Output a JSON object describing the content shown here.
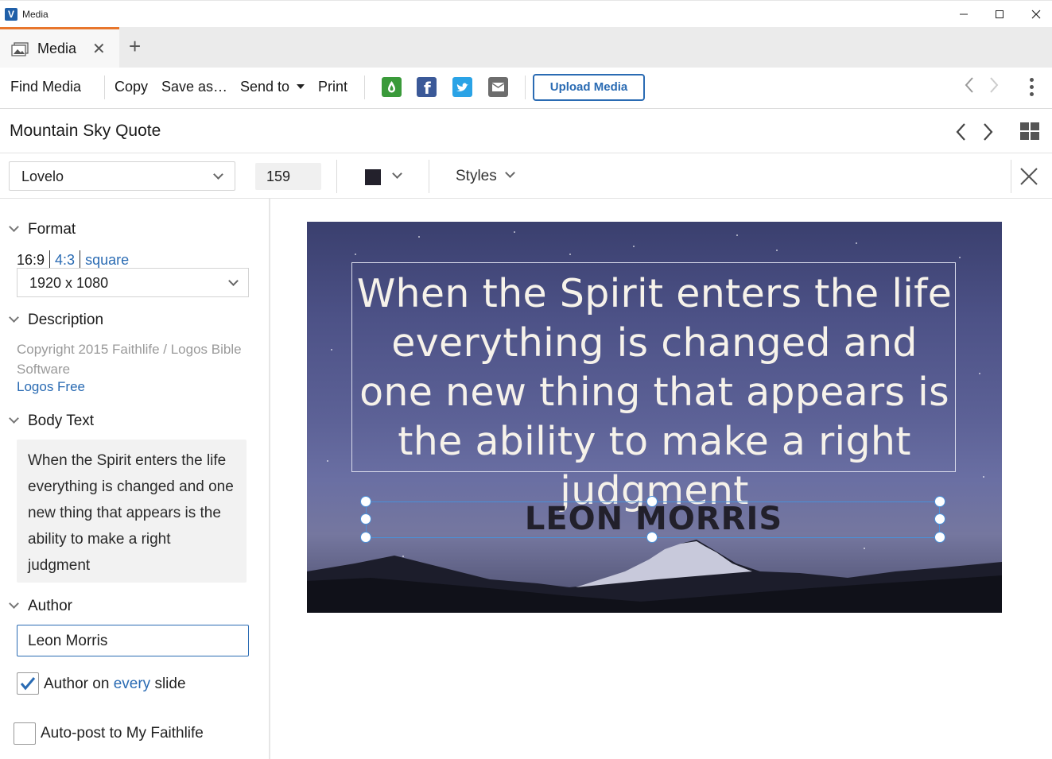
{
  "window": {
    "title": "Media",
    "minimize": "—",
    "maximize": "☐",
    "close": "✕"
  },
  "tabs": [
    {
      "label": "Media",
      "close": "✕"
    }
  ],
  "new_tab": "+",
  "toolbar": {
    "find_media": "Find Media",
    "copy": "Copy",
    "save_as": "Save as…",
    "send_to": "Send to",
    "print": "Print",
    "upload_media": "Upload Media",
    "back": "‹",
    "forward": "›",
    "share_icons": [
      "faithlife-icon",
      "facebook-icon",
      "twitter-icon",
      "email-icon"
    ]
  },
  "document": {
    "title": "Mountain Sky Quote",
    "prev": "‹",
    "next": "›"
  },
  "style_bar": {
    "font": "Lovelo",
    "size": "159",
    "color": "#23212c",
    "styles_label": "Styles"
  },
  "sidebar": {
    "format": {
      "heading": "Format",
      "ratios": [
        "16:9",
        "4:3",
        "square"
      ],
      "selected_ratio": "16:9",
      "dimension": "1920 x 1080"
    },
    "description": {
      "heading": "Description",
      "text": "Copyright 2015 Faithlife / Logos Bible Software",
      "link": "Logos Free"
    },
    "body_text": {
      "heading": "Body Text",
      "value": "When the Spirit enters the life everything is changed and one new thing that appears is the ability to make a right judgment"
    },
    "author": {
      "heading": "Author",
      "value": "Leon Morris",
      "every_slide": {
        "label_pre": "Author on",
        "label_link": "every",
        "label_post": "slide",
        "checked": true
      },
      "auto_post": {
        "label": "Auto-post to My Faithlife",
        "checked": false
      }
    }
  },
  "slide": {
    "quote": "When the Spirit enters the life everything is changed and one new thing that appears is the ability to make a right judgment",
    "author": "LEON MORRIS"
  },
  "colors": {
    "accent": "#2a6bb3",
    "tab_accent": "#e8762c",
    "text_color": "#23212c"
  }
}
